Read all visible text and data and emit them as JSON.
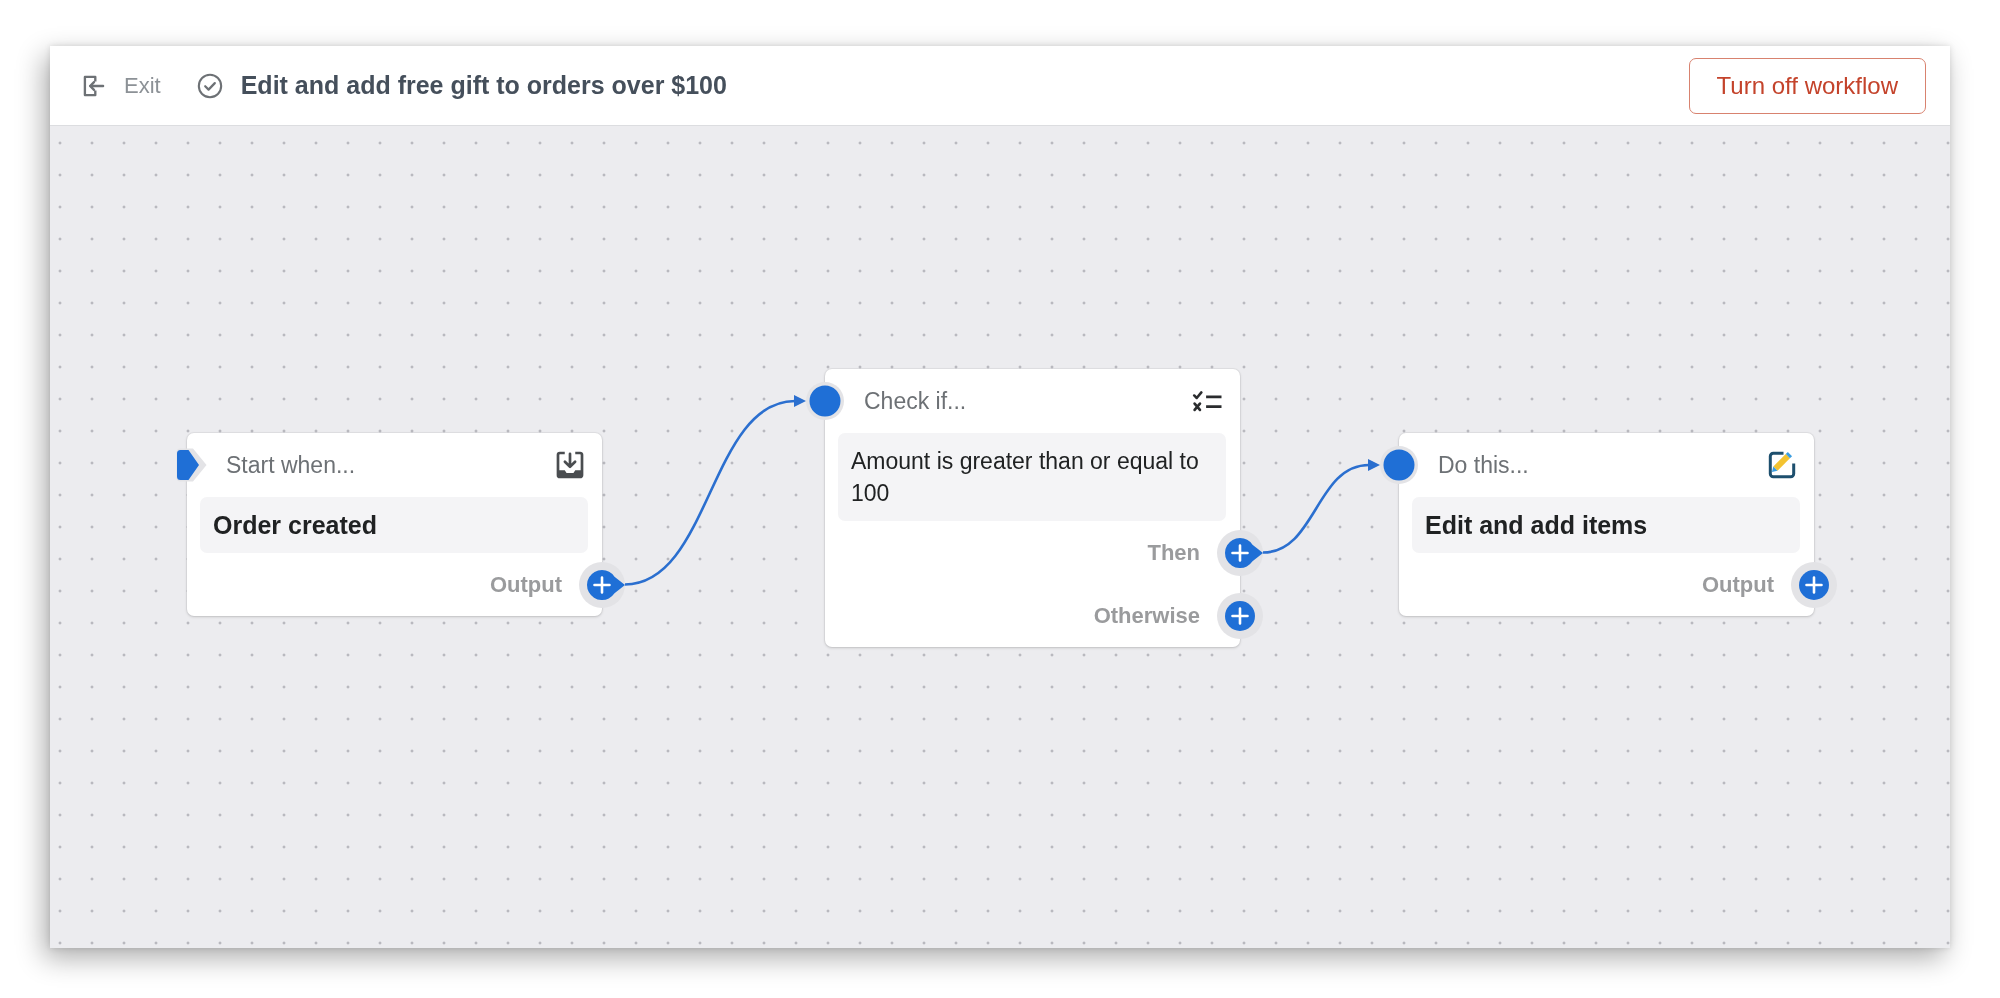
{
  "header": {
    "exit": "Exit",
    "title": "Edit and add free gift to orders over $100",
    "action": "Turn off workflow"
  },
  "nodes": [
    {
      "kind": "trigger",
      "heading": "Start when...",
      "content": "Order created",
      "outputs": [
        {
          "label": "Output",
          "connected": true
        }
      ]
    },
    {
      "kind": "condition",
      "heading": "Check if...",
      "content": "Amount is greater than or equal to 100",
      "outputs": [
        {
          "label": "Then",
          "connected": true
        },
        {
          "label": "Otherwise",
          "connected": false
        }
      ]
    },
    {
      "kind": "action",
      "heading": "Do this...",
      "content": "Edit and add items",
      "outputs": [
        {
          "label": "Output",
          "connected": false
        }
      ]
    }
  ]
}
